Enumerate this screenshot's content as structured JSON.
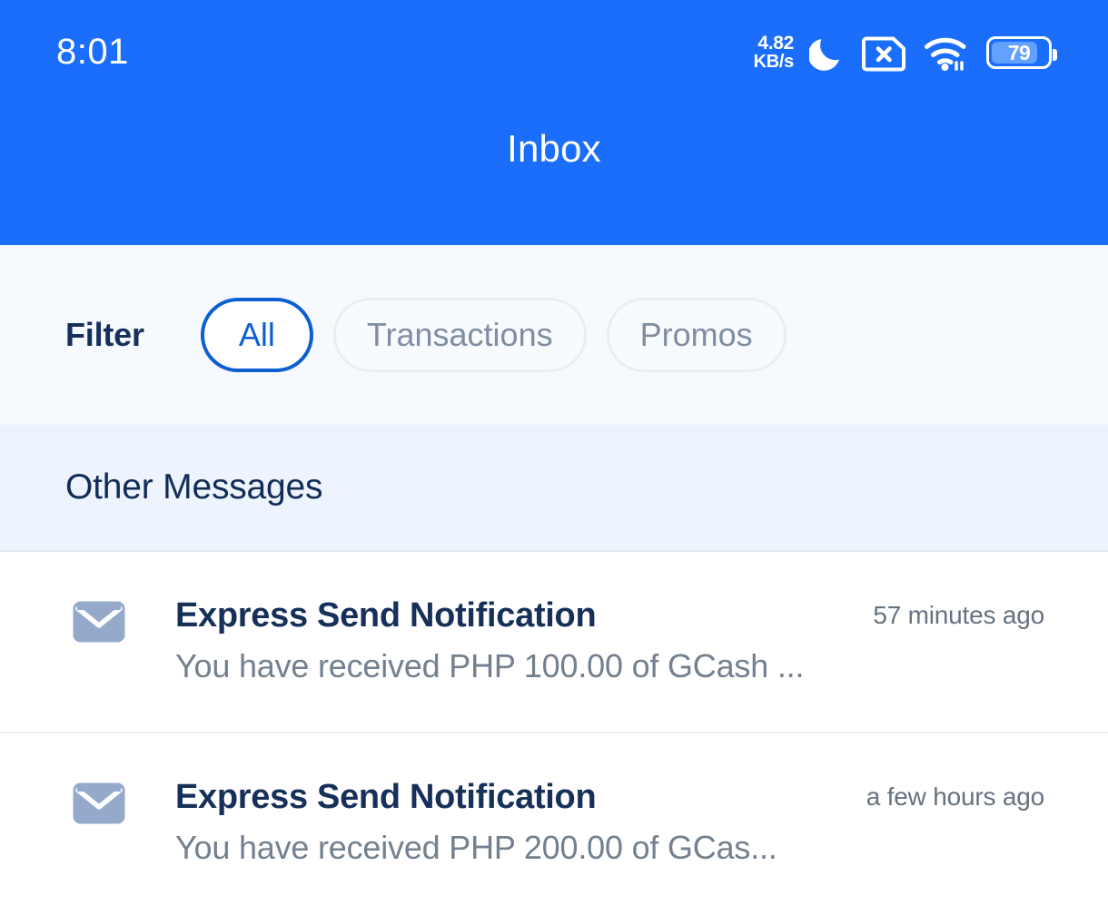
{
  "status_bar": {
    "time": "8:01",
    "network_speed_value": "4.82",
    "network_speed_unit": "KB/s",
    "dnd_icon": "crescent-moon-icon",
    "sim_icon": "sim-card-off-icon",
    "wifi_icon": "wifi-icon",
    "battery_level": "79",
    "battery_percent": 79
  },
  "header": {
    "title": "Inbox",
    "background_color": "#1b6efb",
    "text_color": "#ffffff"
  },
  "filter": {
    "label": "Filter",
    "chips": [
      {
        "label": "All",
        "selected": true
      },
      {
        "label": "Transactions",
        "selected": false
      },
      {
        "label": "Promos",
        "selected": false
      }
    ],
    "selected_color": "#0b5fd0",
    "unselected_text_color": "#7f8da3"
  },
  "section": {
    "title": "Other Messages",
    "background_color": "#edf4fd"
  },
  "messages": [
    {
      "icon": "envelope-icon",
      "title": "Express Send Notification",
      "preview": "You have received PHP 100.00 of GCash ...",
      "time": "57 minutes ago"
    },
    {
      "icon": "envelope-icon",
      "title": "Express Send Notification",
      "preview": "You have received PHP 200.00 of GCas...",
      "time": "a few hours ago"
    }
  ]
}
